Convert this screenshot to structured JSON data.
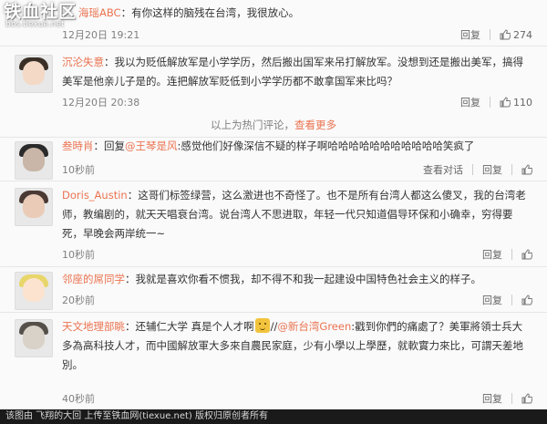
{
  "watermark": {
    "logo": "铁血社区",
    "sub": "bbs.tiexue.net"
  },
  "hot_separator": {
    "prefix": "以上为热门评论，",
    "more": "查看更多"
  },
  "labels": {
    "reply": "回复",
    "view_thread": "查看对话"
  },
  "comments": [
    {
      "user": "海瑶ABC",
      "body": "：有你这样的脑残在台湾，我很放心。",
      "time": "12月20日 19:21",
      "likes": "274"
    },
    {
      "user": "沉沦失意",
      "body": "：我以为贬低解放军是小学学历，然后搬出国军来吊打解放军。没想到还是搬出美军，搞得美军是他亲儿子是的。连把解放军贬低到小学学历都不敢拿国军来比吗？",
      "time": "12月20日 20:38",
      "likes": "110"
    },
    {
      "user": "叁時肖",
      "reply_prefix": "：回复",
      "mention": "@王琴是风",
      "body": ":感觉他们好像深信不疑的样子啊哈哈哈哈哈哈哈哈哈哈哈笑疯了",
      "time": "10秒前"
    },
    {
      "user": "Doris_Austin",
      "body": "：这哥们标签绿营，这么激进也不奇怪了。也不是所有台湾人都这么傻叉，我的台湾老师，教编剧的，就天天唱衰台湾。说台湾人不思进取，年轻一代只知道倡导环保和小确幸，穷得要死，早晚会两岸统一~",
      "time": "10秒前"
    },
    {
      "user": "邻座的屌同学",
      "body": "：我就是喜欢你看不惯我，却不得不和我一起建设中国特色社会主义的样子。",
      "time": "20秒前"
    },
    {
      "user": "天文地理部眺",
      "body_a": "：还辅仁大学 真是个人才啊",
      "body_b": "//",
      "mention": "@新台湾Green",
      "body_c": ":戳到你們的痛處了？美軍將領士兵大多為高科技人才，而中國解放軍大多來自農民家庭，少有小學以上學歷，就軟實力來比，可謂天差地別。",
      "time": "40秒前"
    }
  ],
  "footer": "该图由 飞翔的大回 上传至铁血网(tiexue.net) 版权归原创者所有",
  "colors": {
    "accent": "#eb7350",
    "muted": "#808080",
    "footer_bg": "#1a1a1a"
  }
}
